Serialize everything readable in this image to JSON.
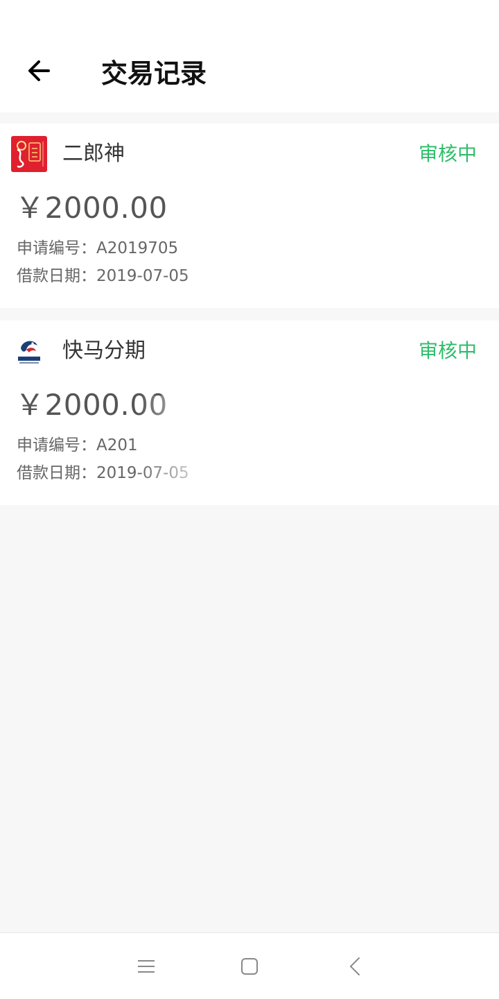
{
  "header": {
    "title": "交易记录"
  },
  "records": [
    {
      "name": "二郎神",
      "status": "审核中",
      "amount": "￥2000.00",
      "application_number": "申请编号：A2019705",
      "loan_date": "借款日期：2019-07-05",
      "logo_text": "二郎神"
    },
    {
      "name": "快马分期",
      "status": "审核中",
      "amount": "￥2000.00",
      "application_number": "申请编号：A201",
      "loan_date": "借款日期：2019-07-05",
      "logo_text": "快马分期"
    }
  ],
  "colors": {
    "status_green": "#2fbd6a",
    "logo_red": "#e0202e",
    "logo_navy": "#1a3f78"
  },
  "nav": {
    "menu_icon": "menu-icon",
    "home_icon": "home-icon",
    "back_icon": "back-icon"
  }
}
